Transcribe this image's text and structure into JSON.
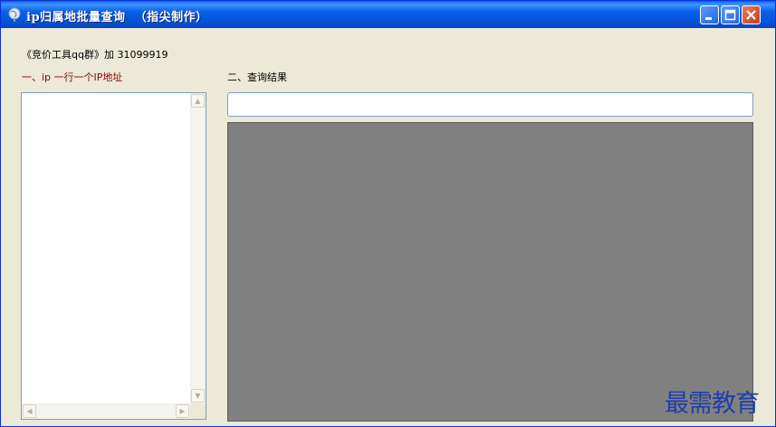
{
  "window": {
    "title": "ip归属地批量查询  （指尖制作）",
    "min_symbol": "▁",
    "max_symbol": "□",
    "close_symbol": "✕"
  },
  "info": {
    "group_text": "《竞价工具qq群》加 31099919"
  },
  "left_panel": {
    "label": "一、ip 一行一个IP地址",
    "input_value": "",
    "scroll_up": "▲",
    "scroll_down": "▼",
    "scroll_left": "◀",
    "scroll_right": "▶"
  },
  "right_panel": {
    "label": "二、查询结果",
    "result_field_value": ""
  },
  "watermark": {
    "text": "最需教育"
  },
  "colors": {
    "titlebar": "#0a5fe8",
    "window_bg": "#ece9d8",
    "results_bg": "#808080",
    "left_label": "#8b0000",
    "watermark": "#1e3fa8"
  },
  "icons": {
    "app": "globe-icon"
  }
}
